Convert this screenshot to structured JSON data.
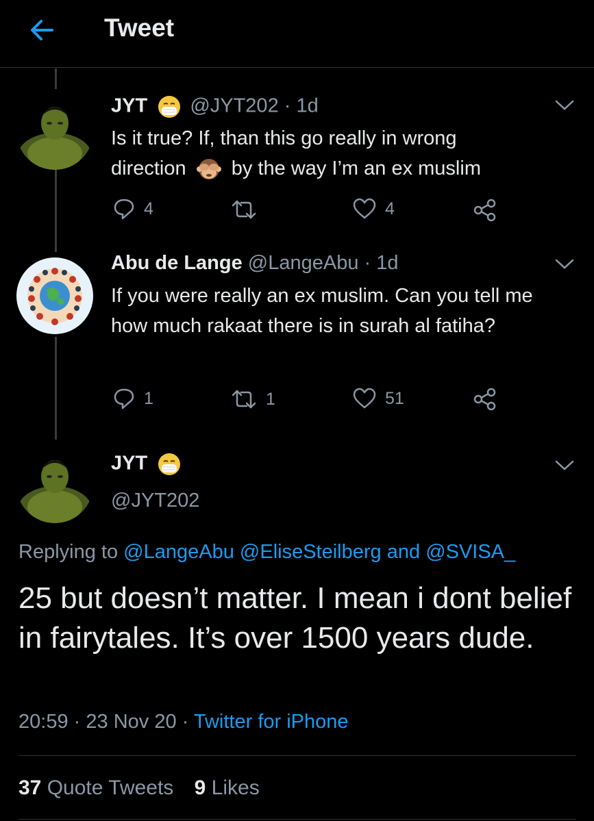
{
  "header": {
    "title": "Tweet"
  },
  "tweet1": {
    "name": "JYT",
    "handle_time": "@JYT202 · 1d",
    "text_line1": "Is it true? If, than this go really in wrong",
    "text_line2a": "direction",
    "text_line2b": "by the way I’m an ex muslim",
    "replies": "4",
    "retweets": "",
    "likes": "4"
  },
  "tweet2": {
    "name": "Abu de Lange",
    "handle_time": "@LangeAbu · 1d",
    "text": "If you were really an ex muslim. Can you tell me how much rakaat there is in surah al fatiha?",
    "replies": "1",
    "retweets": "1",
    "likes": "51"
  },
  "main_tweet": {
    "name": "JYT",
    "handle": "@JYT202",
    "replying_prefix": "Replying to",
    "reply_user1": "@LangeAbu",
    "reply_user2": "@EliseSteilberg",
    "reply_and": "and",
    "reply_user3": "@SVISA_",
    "text": "25 but doesn’t matter. I mean i dont belief in fairytales. It’s over 1500 years dude.",
    "time": "20:59",
    "date": "23 Nov 20",
    "source": "Twitter for iPhone",
    "quote_count": "37",
    "quote_label": "Quote Tweets",
    "likes_count": "9",
    "likes_label": "Likes"
  },
  "colors": {
    "accent": "#1d9bf0",
    "secondary_text": "#8b98a5",
    "background": "#000000"
  },
  "icons": [
    "back-arrow-icon",
    "mask-face-emoji",
    "see-no-evil-monkey-emoji",
    "reply-icon",
    "retweet-icon",
    "like-icon",
    "share-icon",
    "chevron-down-icon"
  ]
}
